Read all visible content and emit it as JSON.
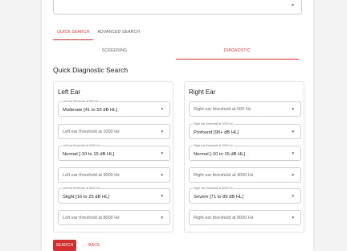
{
  "top_select": {
    "value": ""
  },
  "tabs": [
    {
      "label": "QUICK SEARCH",
      "active": true
    },
    {
      "label": "ADVANCED SEARCH",
      "active": false
    }
  ],
  "subtabs": [
    {
      "label": "SCREENING",
      "active": false
    },
    {
      "label": "DIAGNOSTIC",
      "active": true
    }
  ],
  "section_title": "Quick Diagnostic Search",
  "left": {
    "title": "Left Ear",
    "fields": [
      {
        "label": "Left ear threshold at 500 Hz",
        "value": "Moderate [41 to 55 dB HL]",
        "placeholder": ""
      },
      {
        "label": "",
        "value": "",
        "placeholder": "Left ear threshold at 1000 Hz"
      },
      {
        "label": "Left ear threshold at 2000 Hz",
        "value": "Normal [-10 to 15 dB HL]",
        "placeholder": ""
      },
      {
        "label": "",
        "value": "",
        "placeholder": "Left ear threshold at 4000 Hz"
      },
      {
        "label": "Left ear threshold at 6000 Hz",
        "value": "Slight [16 to 25 dB HL]",
        "placeholder": ""
      },
      {
        "label": "",
        "value": "",
        "placeholder": "Left ear threshold at 8000 Hz"
      }
    ]
  },
  "right": {
    "title": "Right Ear",
    "fields": [
      {
        "label": "",
        "value": "",
        "placeholder": "Right ear threshold at 500 Hz"
      },
      {
        "label": "Right ear threshold at 1000 Hz",
        "value": "Profound [90+ dB HL]",
        "placeholder": ""
      },
      {
        "label": "Right ear threshold at 2000 Hz",
        "value": "Normal [-10 to 15 dB HL]",
        "placeholder": ""
      },
      {
        "label": "",
        "value": "",
        "placeholder": "Right ear threshold at 4000 Hz"
      },
      {
        "label": "Right ear threshold at 6000 Hz",
        "value": "Severe [71 to 89 dB HL]",
        "placeholder": ""
      },
      {
        "label": "",
        "value": "",
        "placeholder": "Right ear threshold at 8000 Hz"
      }
    ]
  },
  "actions": {
    "search_label": "SEARCH",
    "back_arrow": "←",
    "back_label": "BACK"
  },
  "icons": {
    "dropdown": "chevron-down-icon",
    "back": "arrow-left-icon"
  },
  "colors": {
    "accent": "#d32f2f"
  }
}
